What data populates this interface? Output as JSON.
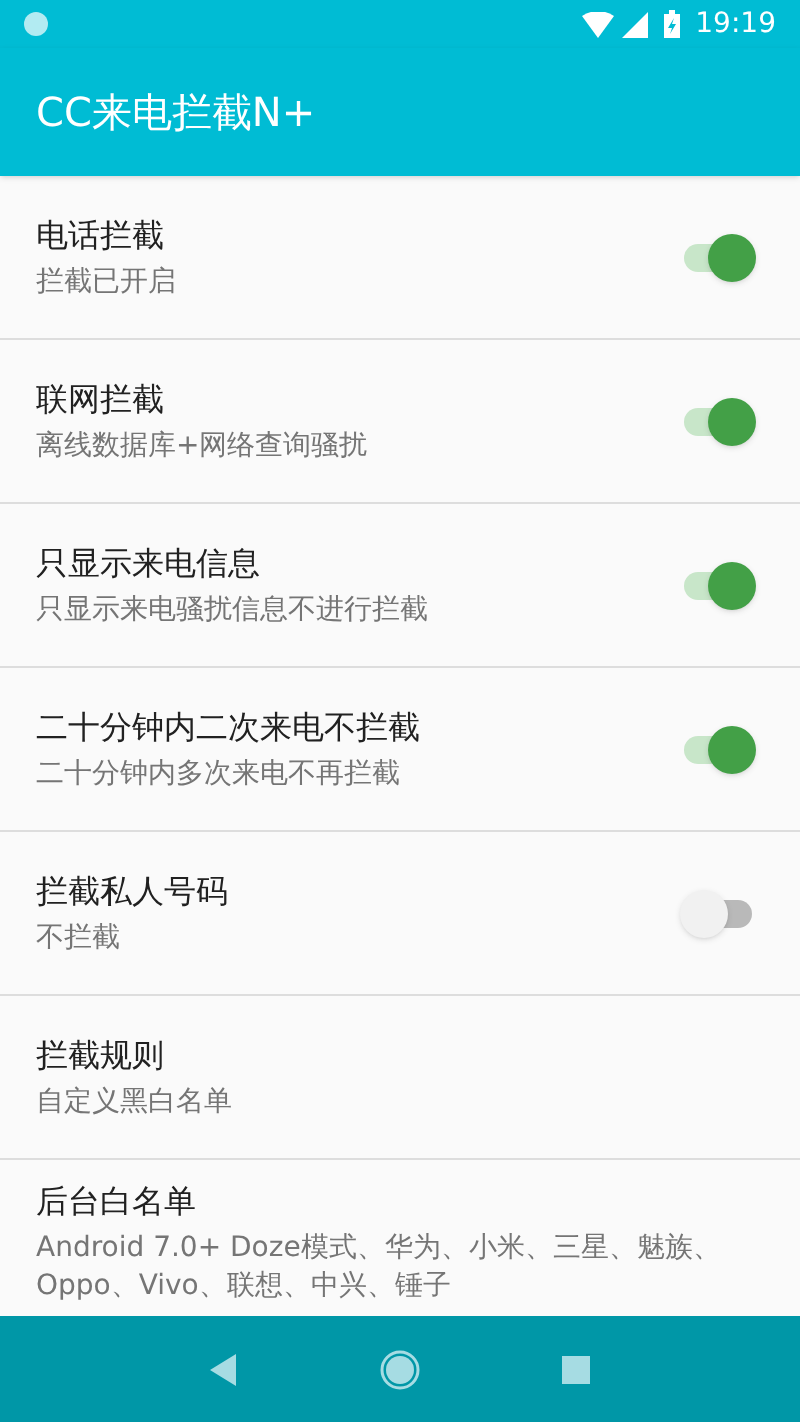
{
  "status_bar": {
    "time": "19:19"
  },
  "app_bar": {
    "title": "CC来电拦截N+"
  },
  "settings": [
    {
      "kind": "toggle",
      "title": "电话拦截",
      "summary": "拦截已开启",
      "on": true
    },
    {
      "kind": "toggle",
      "title": "联网拦截",
      "summary": "离线数据库+网络查询骚扰",
      "on": true
    },
    {
      "kind": "toggle",
      "title": "只显示来电信息",
      "summary": "只显示来电骚扰信息不进行拦截",
      "on": true
    },
    {
      "kind": "toggle",
      "title": "二十分钟内二次来电不拦截",
      "summary": "二十分钟内多次来电不再拦截",
      "on": true
    },
    {
      "kind": "toggle",
      "title": "拦截私人号码",
      "summary": "不拦截",
      "on": false
    },
    {
      "kind": "link",
      "title": "拦截规则",
      "summary": "自定义黑白名单"
    },
    {
      "kind": "link",
      "title": "后台白名单",
      "summary": "Android 7.0+ Doze模式、华为、小米、三星、魅族、Oppo、Vivo、联想、中兴、锤子"
    }
  ]
}
